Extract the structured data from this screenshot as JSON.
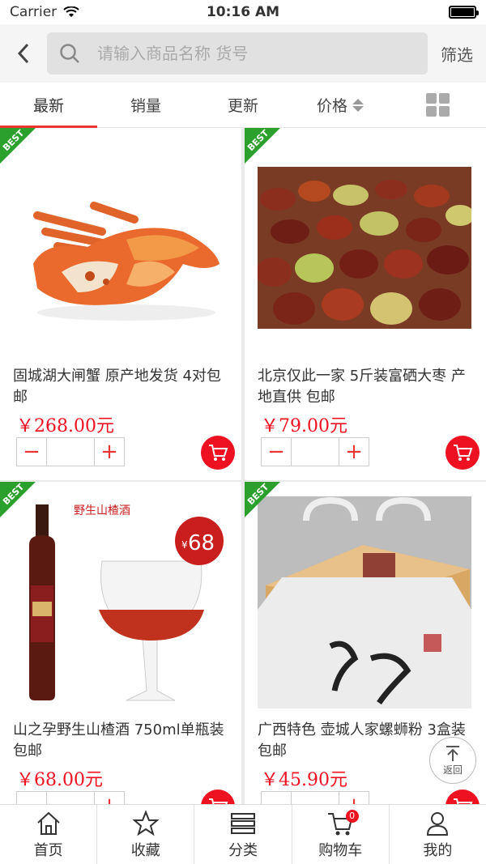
{
  "status_bar": {
    "carrier": "Carrier",
    "time": "10:16 AM"
  },
  "header": {
    "search_placeholder": "请输入商品名称 货号",
    "filter_label": "筛选"
  },
  "tabs": [
    {
      "label": "最新",
      "active": true
    },
    {
      "label": "销量",
      "active": false
    },
    {
      "label": "更新",
      "active": false
    },
    {
      "label": "价格",
      "active": false
    }
  ],
  "badge_text": "BEST",
  "products": [
    {
      "title": "固城湖大闸蟹 原产地发货 4对包邮",
      "price": "￥268.00元",
      "image": "crab-image"
    },
    {
      "title": "北京仅此一家 5斤装富硒大枣 产地直供 包邮",
      "price": "￥79.00元",
      "image": "jujube-image"
    },
    {
      "title": "山之孕野生山楂酒 750ml单瓶装 包邮",
      "price": "￥68.00元",
      "image": "wine-image",
      "image_caption": "野生山楂酒",
      "image_price": "68"
    },
    {
      "title": "广西特色 壶城人家螺蛳粉 3盒装 包邮",
      "price": "￥45.90元",
      "image": "noodle-box-image"
    }
  ],
  "back_to_top": {
    "label": "返回"
  },
  "bottom_nav": [
    {
      "label": "首页",
      "icon": "home-icon"
    },
    {
      "label": "收藏",
      "icon": "star-icon"
    },
    {
      "label": "分类",
      "icon": "category-icon"
    },
    {
      "label": "购物车",
      "icon": "cart-icon",
      "badge": "0"
    },
    {
      "label": "我的",
      "icon": "user-icon"
    }
  ],
  "colors": {
    "accent": "#e11b22",
    "best_badge": "#2ca02c",
    "tab_underline": "#e33333"
  }
}
